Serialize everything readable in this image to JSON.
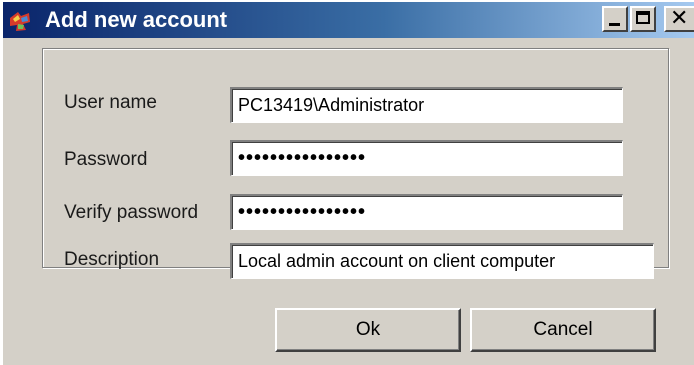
{
  "window": {
    "title": "Add new account",
    "icon": "app-icon",
    "controls": {
      "minimize": "minimize-icon",
      "maximize": "maximize-icon",
      "close": "close-icon"
    }
  },
  "form": {
    "user_name": {
      "label": "User name",
      "value": "PC13419\\Administrator"
    },
    "password": {
      "label": "Password",
      "value": "pppppppppppppppp"
    },
    "verify_password": {
      "label": "Verify password",
      "value": "pppppppppppppppp"
    },
    "description": {
      "label": "Description",
      "value": "Local admin account on client computer"
    }
  },
  "buttons": {
    "ok": "Ok",
    "cancel": "Cancel"
  }
}
